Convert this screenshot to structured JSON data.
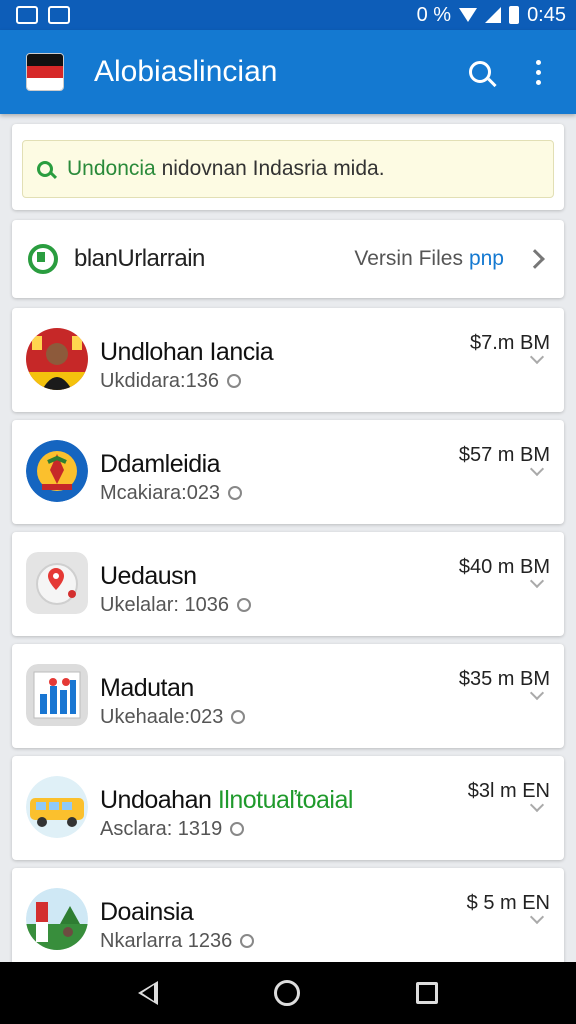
{
  "status_bar": {
    "left_icons": [
      "chart-app-icon",
      "gallery-app-icon"
    ],
    "indicator": "0 %",
    "time": "0:45"
  },
  "app_bar": {
    "title": "Alobiaslincian",
    "flag_icon": "indonesia-flag-icon"
  },
  "search": {
    "query_prefix": "Undoncia",
    "query_rest": " nidovnan Indasria mida."
  },
  "category": {
    "label": "blanUrlarrain",
    "right_text": "Versin Files",
    "right_accent": "pnp"
  },
  "items": [
    {
      "title": "Undlohan Iancia",
      "title_accent": "",
      "subtitle": "Ukdidara:136",
      "price": "$7.m BM",
      "icon": "portrait-avatar-icon"
    },
    {
      "title": "Ddamleidia",
      "title_accent": "",
      "subtitle": "Mcakiara:023",
      "price": "$57 m BM",
      "icon": "emblem-avatar-icon"
    },
    {
      "title": "Uedausn",
      "title_accent": "",
      "subtitle": "Ukelalar: 1036",
      "price": "$40 m BM",
      "icon": "map-pin-icon"
    },
    {
      "title": "Madutan",
      "title_accent": "",
      "subtitle": "Ukehaale:023",
      "price": "$35 m BM",
      "icon": "bar-chart-icon"
    },
    {
      "title": "Undoahan ",
      "title_accent": "Ilnotuaľtoaial",
      "subtitle": "Asclara: 1319",
      "price": "$3l m EN",
      "icon": "bus-icon"
    },
    {
      "title": "Doainsia",
      "title_accent": "",
      "subtitle": "Nkarlarra 1236",
      "price": "$ 5 m EN",
      "icon": "landscape-avatar-icon"
    }
  ],
  "colors": {
    "status_bar": "#0d5db8",
    "app_bar": "#1479d1",
    "accent_green": "#1f9a2c",
    "background": "#e9ebee"
  }
}
